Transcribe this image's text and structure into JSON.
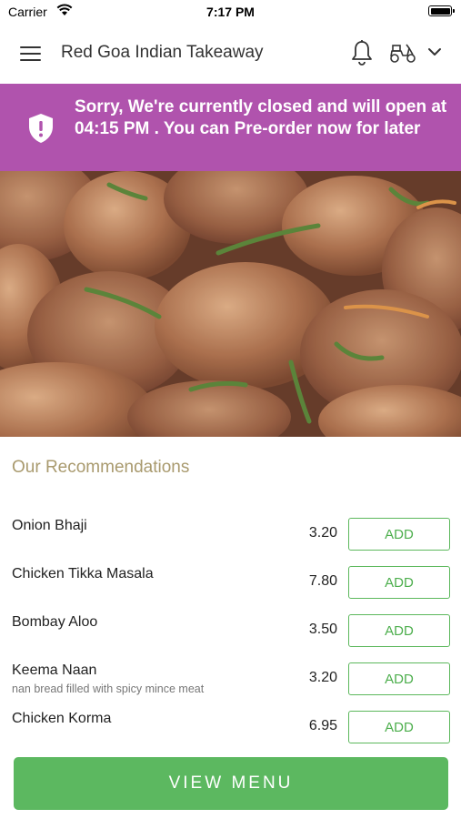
{
  "status_bar": {
    "carrier": "Carrier",
    "time": "7:17 PM"
  },
  "header": {
    "title": "Red Goa Indian Takeaway",
    "icons": [
      "menu-icon",
      "bell-icon",
      "scooter-icon",
      "chevron-down-icon"
    ]
  },
  "banner": {
    "text": "Sorry, We're currently closed and will open at 04:15 PM . You can Pre-order now for later",
    "icon": "shield-alert-icon",
    "background": "#b053ad"
  },
  "hero": {
    "image": "chicken-curry-photo"
  },
  "recommendations": {
    "title": "Our Recommendations",
    "items": [
      {
        "name": "Onion Bhaji",
        "description": "",
        "price": "3.20",
        "add_label": "ADD"
      },
      {
        "name": "Chicken Tikka Masala",
        "description": "",
        "price": "7.80",
        "add_label": "ADD"
      },
      {
        "name": "Bombay Aloo",
        "description": "",
        "price": "3.50",
        "add_label": "ADD"
      },
      {
        "name": "Keema Naan",
        "description": "nan bread filled with spicy mince meat",
        "price": "3.20",
        "add_label": "ADD"
      },
      {
        "name": "Chicken Korma",
        "description": "",
        "price": "6.95",
        "add_label": "ADD"
      }
    ]
  },
  "footer": {
    "view_menu_label": "VIEW MENU"
  },
  "colors": {
    "accent_green": "#5cb860",
    "section_title": "#a99a6e",
    "banner": "#b053ad"
  }
}
